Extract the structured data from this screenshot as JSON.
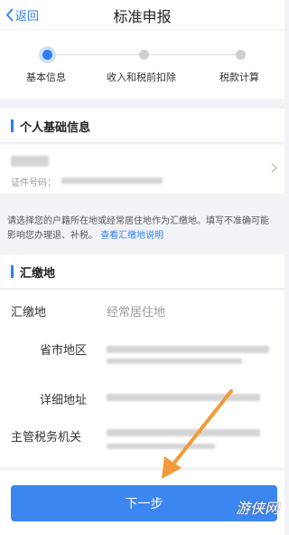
{
  "header": {
    "back_label": "返回",
    "title": "标准申报"
  },
  "steps": [
    {
      "label": "基本信息",
      "active": true
    },
    {
      "label": "收入和税前扣除",
      "active": false
    },
    {
      "label": "税款计算",
      "active": false
    }
  ],
  "personal": {
    "section_title": "个人基础信息",
    "id_label": "证件号码："
  },
  "notice": {
    "text": "请选择您的户籍所在地或经常居住地作为汇缴地。填写不准确可能影响您办理退、补税。",
    "link": "查看汇缴地说明"
  },
  "payment": {
    "section_title": "汇缴地",
    "location_label": "汇缴地",
    "location_value": "经常居住地",
    "province_label": "省市地区",
    "address_label": "详细地址",
    "tax_office_label": "主管税务机关"
  },
  "footer": {
    "next_label": "下一步",
    "watermark": "游侠网"
  },
  "colors": {
    "accent": "#2f7ef5",
    "arrow": "#f39a3a"
  }
}
